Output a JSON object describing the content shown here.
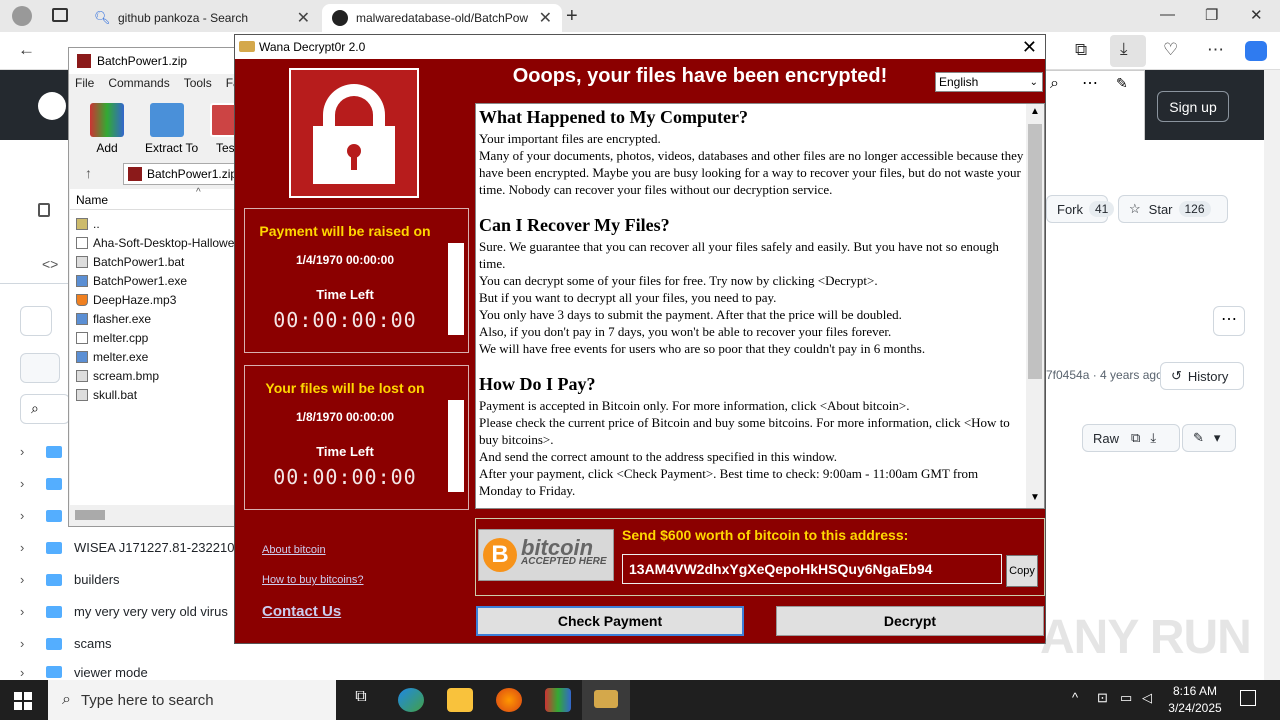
{
  "browser": {
    "tabs": [
      {
        "label": "github pankoza - Search"
      },
      {
        "label": "malwaredatabase-old/BatchPow"
      }
    ]
  },
  "github": {
    "signup": "Sign up",
    "fork_label": "Fork",
    "fork_count": "41",
    "star_label": "Star",
    "star_count": "126",
    "commit_info": "7f0454a · 4 years ago",
    "history": "History",
    "raw": "Raw",
    "tree": [
      {
        "label": ""
      },
      {
        "label": ""
      },
      {
        "label": ""
      },
      {
        "label": "WISEA J171227.81-232210"
      },
      {
        "label": "builders"
      },
      {
        "label": "my very very very old virus"
      },
      {
        "label": "scams"
      },
      {
        "label": "viewer mode"
      }
    ]
  },
  "winrar": {
    "title": "BatchPower1.zip",
    "menu": [
      "File",
      "Commands",
      "Tools",
      "Fa"
    ],
    "tools": [
      "Add",
      "Extract To",
      "Test"
    ],
    "path": "BatchPower1.zip",
    "col_name": "Name",
    "files": [
      "..",
      "Aha-Soft-Desktop-Hallowe",
      "BatchPower1.bat",
      "BatchPower1.exe",
      "DeepHaze.mp3",
      "flasher.exe",
      "melter.cpp",
      "melter.exe",
      "scream.bmp",
      "skull.bat"
    ]
  },
  "wannacry": {
    "title": "Wana Decrypt0r 2.0",
    "headline": "Ooops, your files have been encrypted!",
    "language": "English",
    "raise_label": "Payment will be raised on",
    "raise_date": "1/4/1970 00:00:00",
    "lost_label": "Your files will be lost on",
    "lost_date": "1/8/1970 00:00:00",
    "time_left": "Time Left",
    "clock": "00:00:00:00",
    "about_bitcoin": "About bitcoin",
    "how_to_buy": "How to buy bitcoins?",
    "contact": "Contact Us",
    "sections": [
      {
        "heading": "What Happened to My Computer?",
        "lines": [
          "Your important files are encrypted.",
          "Many of your documents, photos, videos, databases and other files are no longer accessible because they have been encrypted. Maybe you are busy looking for a way to recover your files, but do not waste your time. Nobody can recover your files without our decryption service."
        ]
      },
      {
        "heading": "Can I Recover My Files?",
        "lines": [
          "Sure. We guarantee that you can recover all your files safely and easily. But you have not so enough time.",
          "You can decrypt some of your files for free. Try now by clicking <Decrypt>.",
          "But if you want to decrypt all your files, you need to pay.",
          "You only have 3 days to submit the payment. After that the price will be doubled.",
          "Also, if you don't pay in 7 days, you won't be able to recover your files forever.",
          "We will have free events for users who are so poor that they couldn't pay in 6 months."
        ]
      },
      {
        "heading": "How Do I Pay?",
        "lines": [
          "Payment is accepted in Bitcoin only. For more information, click <About bitcoin>.",
          "Please check the current price of Bitcoin and buy some bitcoins. For more information, click <How to buy bitcoins>.",
          "And send the correct amount to the address specified in this window.",
          "After your payment, click <Check Payment>. Best time to check: 9:00am - 11:00am GMT from Monday to Friday."
        ]
      }
    ],
    "bitcoin_big": "bitcoin",
    "bitcoin_small": "ACCEPTED HERE",
    "send_label": "Send $600 worth of bitcoin to this address:",
    "address": "13AM4VW2dhxYgXeQepoHkHSQuy6NgaEb94",
    "copy": "Copy",
    "check_payment": "Check Payment",
    "decrypt": "Decrypt"
  },
  "taskbar": {
    "search_placeholder": "Type here to search",
    "time": "8:16 AM",
    "date": "3/24/2025"
  },
  "watermark": "ANY RUN"
}
